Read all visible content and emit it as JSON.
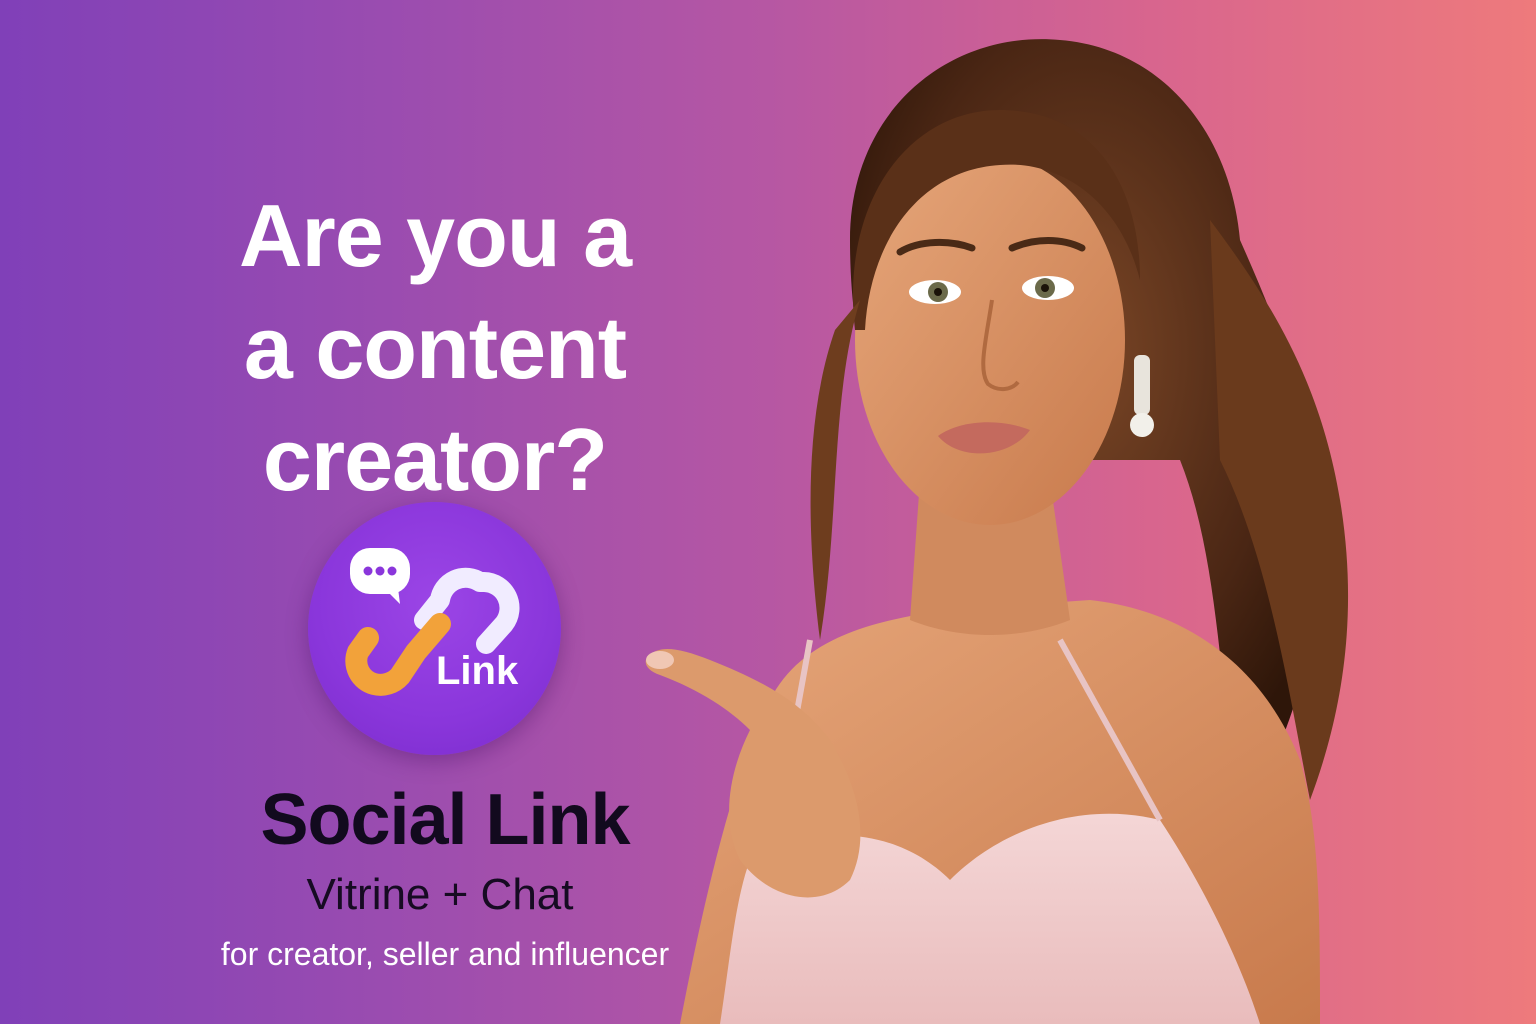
{
  "headline": {
    "line1": "Are you a",
    "line2": "a content",
    "line3": "creator?"
  },
  "logo": {
    "text": "Link",
    "icons": [
      "chat-bubble-icon",
      "chain-link-icon"
    ]
  },
  "brand": {
    "name": "Social Link",
    "tagline": "Vitrine + Chat",
    "subtitle": "for creator, seller and influencer"
  },
  "colors": {
    "background_start": "#8040b8",
    "background_end": "#ee7a7c",
    "logo_purple": "#8a36db",
    "link_orange": "#f2a23a",
    "link_white": "#f1ecff"
  }
}
